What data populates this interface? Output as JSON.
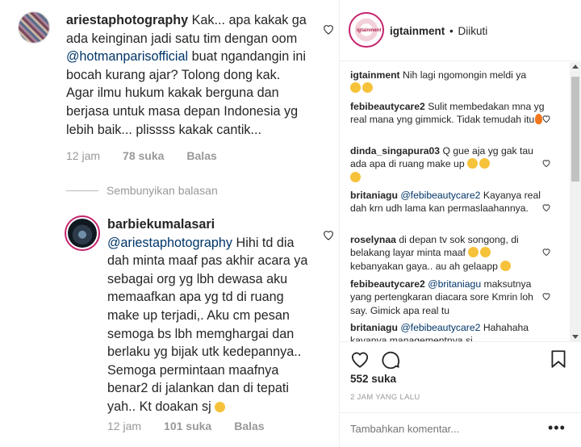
{
  "left": {
    "comment1": {
      "username": "ariestaphotography",
      "text_before": " Kak... apa kakak ga ada keinginan jadi satu tim dengan oom ",
      "mention": "@hotmanparisofficial",
      "text_after": " buat ngandangin ini bocah kurang ajar? Tolong dong kak. Agar ilmu hukum kakak berguna dan berjasa untuk masa depan Indonesia yg lebih baik... plissss kakak cantik...",
      "time": "12 jam",
      "likes": "78 suka",
      "reply": "Balas"
    },
    "hide_replies": "Sembunyikan balasan",
    "comment2": {
      "username": "barbiekumalasari",
      "mention": "@ariestaphotography",
      "text": " Hihi td dia dah minta maaf pas akhir acara ya sebagai org yg lbh dewasa aku memaafkan apa yg td di ruang make up terjadi,. Aku cm pesan semoga bs lbh memghargai dan berlaku yg bijak utk kedepannya.. Semoga permintaan maafnya benar2 di jalankan dan di tepati yah.. Kt doakan sj",
      "time": "12 jam",
      "likes": "101 suka",
      "reply": "Balas"
    }
  },
  "right": {
    "header": {
      "username": "igtainment",
      "separator": "•",
      "follow_status": "Diikuti",
      "avatar_text": "igtainment"
    },
    "comments": [
      {
        "user": "igtainment",
        "text": "Nih lagi ngomongin meldi ya",
        "emojis": 2
      },
      {
        "user": "febibeautycare2",
        "text": "Sulit membedakan mna yg real mana yng gimmick. Tidak temudah itu",
        "emojis": 0,
        "fire": true
      },
      {
        "user": "dinda_singapura03",
        "text": "Q gue aja yg gak tau ada apa di ruang make up",
        "emojis": 3
      },
      {
        "user": "britaniagu",
        "mention": "@febibeautycare2",
        "text": "Kayanya real dah krn udh lama kan permaslaahannya.",
        "emojis": 0
      },
      {
        "user": "roselynaa",
        "text": "di depan tv sok songong, di belakang layar minta maaf",
        "text2": "kebanyakan gaya.. au ah gelaapp",
        "emojis": 0
      },
      {
        "user": "febibeautycare2",
        "mention": "@britaniagu",
        "text": "maksutnya yang pertengkaran diacara sore Kmrin loh say. Gimick apa real tu",
        "emojis": 0
      },
      {
        "user": "britaniagu",
        "mention": "@febibeautycare2",
        "text": "Hahahaha kayanya managementnya si",
        "emojis": 0
      }
    ],
    "likes": "552 suka",
    "time_ago": "2 JAM YANG LALU",
    "comment_placeholder": "Tambahkan komentar...",
    "more": "•••"
  },
  "colors": {
    "text": "#262626",
    "muted": "#999999",
    "mention": "#003569",
    "ring": "#c5246c"
  }
}
